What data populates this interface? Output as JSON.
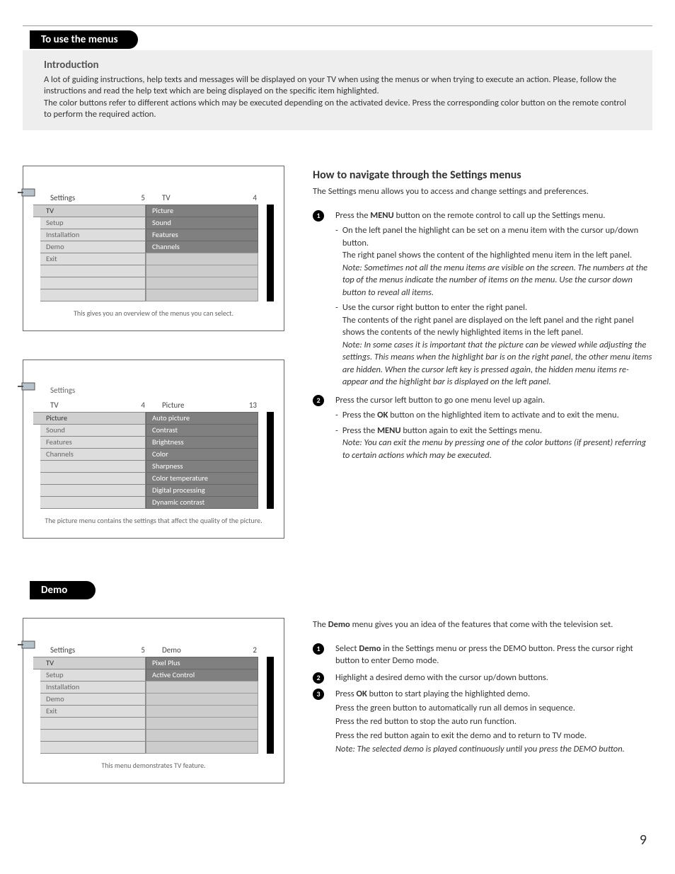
{
  "page_number": "9",
  "title1": "To use the menus",
  "intro": {
    "heading": "Introduction",
    "p1": "A lot of guiding instructions, help texts and messages will be displayed on your TV when using the menus or when trying to execute an action. Please, follow the instructions and read the help text which are being displayed on the specific item highlighted.",
    "p2": "The color buttons refer to different actions which may be executed depending on the activated device. Press the corresponding color button on the remote control to perform the required action."
  },
  "howto": {
    "heading": "How to navigate through the Settings menus",
    "lead": "The Settings menu allows you to access and change settings and preferences.",
    "step1_a": "Press the ",
    "step1_b": "MENU",
    "step1_c": " button on the remote control to call up the Settings menu.",
    "s1_sub1_a": "On the left panel the highlight can be set on a menu item with the cursor up/down button.",
    "s1_sub1_b": "The right panel shows the content of the highlighted menu item in the left panel.",
    "s1_note1": "Note: Sometimes not all the menu items are visible on the screen. The numbers at the top of the menus indicate the number of items on the menu.  Use the cursor down button to reveal all items.",
    "s1_sub2_a": "Use the cursor right button to enter the right panel.",
    "s1_sub2_b": "The contents of the right panel are displayed on the left panel and the right panel shows the contents of the newly highlighted items in the left panel.",
    "s1_note2": "Note: In some cases it is important that the picture can be viewed while adjusting the settings. This means when the highlight bar is on the right panel, the other menu items are hidden.  When the cursor left key is pressed again, the hidden menu items re-appear and the highlight bar is displayed on the left panel.",
    "step2": "Press the cursor left button to go one menu level up again.",
    "s2_sub1_a": "Press the ",
    "s2_sub1_b": "OK",
    "s2_sub1_c": " button on the highlighted item to activate and to exit the menu.",
    "s2_sub2_a": "Press the ",
    "s2_sub2_b": "MENU",
    "s2_sub2_c": " button again to exit the Settings menu.",
    "s2_note": "Note: You can exit the menu by pressing one of the color buttons (if present) referring to certain actions which may be executed."
  },
  "osd1": {
    "left_title": "Settings",
    "left_count": "5",
    "right_title": "TV",
    "right_count": "4",
    "left_items": [
      "TV",
      "Setup",
      "Installation",
      "Demo",
      "Exit"
    ],
    "right_items": [
      "Picture",
      "Sound",
      "Features",
      "Channels"
    ],
    "caption": "This gives you an overview of the menus you can select."
  },
  "osd2": {
    "top_label": "Settings",
    "left_title": "TV",
    "left_count": "4",
    "right_title": "Picture",
    "right_count": "13",
    "left_items": [
      "Picture",
      "Sound",
      "Features",
      "Channels"
    ],
    "right_items": [
      "Auto picture",
      "Contrast",
      "Brightness",
      "Color",
      "Sharpness",
      "Color temperature",
      "Digital processing",
      "Dynamic contrast"
    ],
    "caption": "The picture menu contains the settings that affect the quality of the picture."
  },
  "title2": "Demo",
  "osd3": {
    "left_title": "Settings",
    "left_count": "5",
    "right_title": "Demo",
    "right_count": "2",
    "left_items": [
      "TV",
      "Setup",
      "Installation",
      "Demo",
      "Exit"
    ],
    "right_items": [
      "Pixel Plus",
      "Active Control"
    ],
    "caption": "This menu demonstrates TV feature."
  },
  "demo": {
    "lead_a": "The ",
    "lead_b": "Demo",
    "lead_c": " menu gives you an idea of the features that come with the television set.",
    "step1_a": "Select ",
    "step1_b": "Demo",
    "step1_c": " in the Settings menu or press the DEMO button.  Press the cursor right button to enter Demo mode.",
    "step2": "Highlight a desired demo with the cursor up/down buttons.",
    "step3_a": "Press ",
    "step3_b": "OK",
    "step3_c": " button to start playing the highlighted demo.",
    "step3_d": "Press the green button to automatically run all demos in sequence.",
    "step3_e": "Press the red button to stop the auto run function.",
    "step3_f": "Press the red button again to exit the demo and to return to TV mode.",
    "step3_note": "Note: The selected demo is played continuously until you press the DEMO button."
  }
}
